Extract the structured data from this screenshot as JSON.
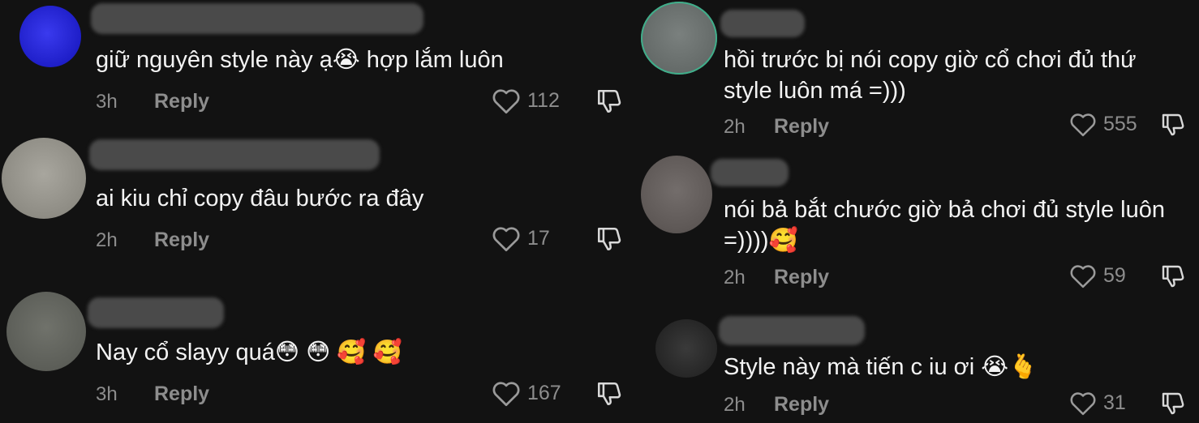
{
  "comments_left": [
    {
      "text": "giữ nguyên style này ạ😭  hợp lắm luôn",
      "time": "3h",
      "reply": "Reply",
      "likes": "112",
      "avatar_color": "#2a2ad8"
    },
    {
      "text": "ai kiu chỉ copy đâu bước ra đây",
      "time": "2h",
      "reply": "Reply",
      "likes": "17",
      "avatar_color": "#9a9890"
    },
    {
      "text": "Nay cổ slayy quá😳 😳 🥰 🥰",
      "time": "3h",
      "reply": "Reply",
      "likes": "167",
      "avatar_color": "#6a6c66"
    }
  ],
  "comments_right": [
    {
      "text": "hồi trước bị nói copy giờ cổ chơi đủ thứ\nstyle luôn má =)))",
      "time": "2h",
      "reply": "Reply",
      "likes": "555",
      "avatar_color": "#6e7472"
    },
    {
      "text": "nói bả bắt chước giờ bả chơi đủ style luôn\n=))))🥰",
      "time": "2h",
      "reply": "Reply",
      "likes": "59",
      "avatar_color": "#6a6462"
    },
    {
      "text": "Style này mà tiến c iu ơi 😭🫰",
      "time": "2h",
      "reply": "Reply",
      "likes": "31",
      "avatar_color": "#2e2e2e"
    }
  ]
}
